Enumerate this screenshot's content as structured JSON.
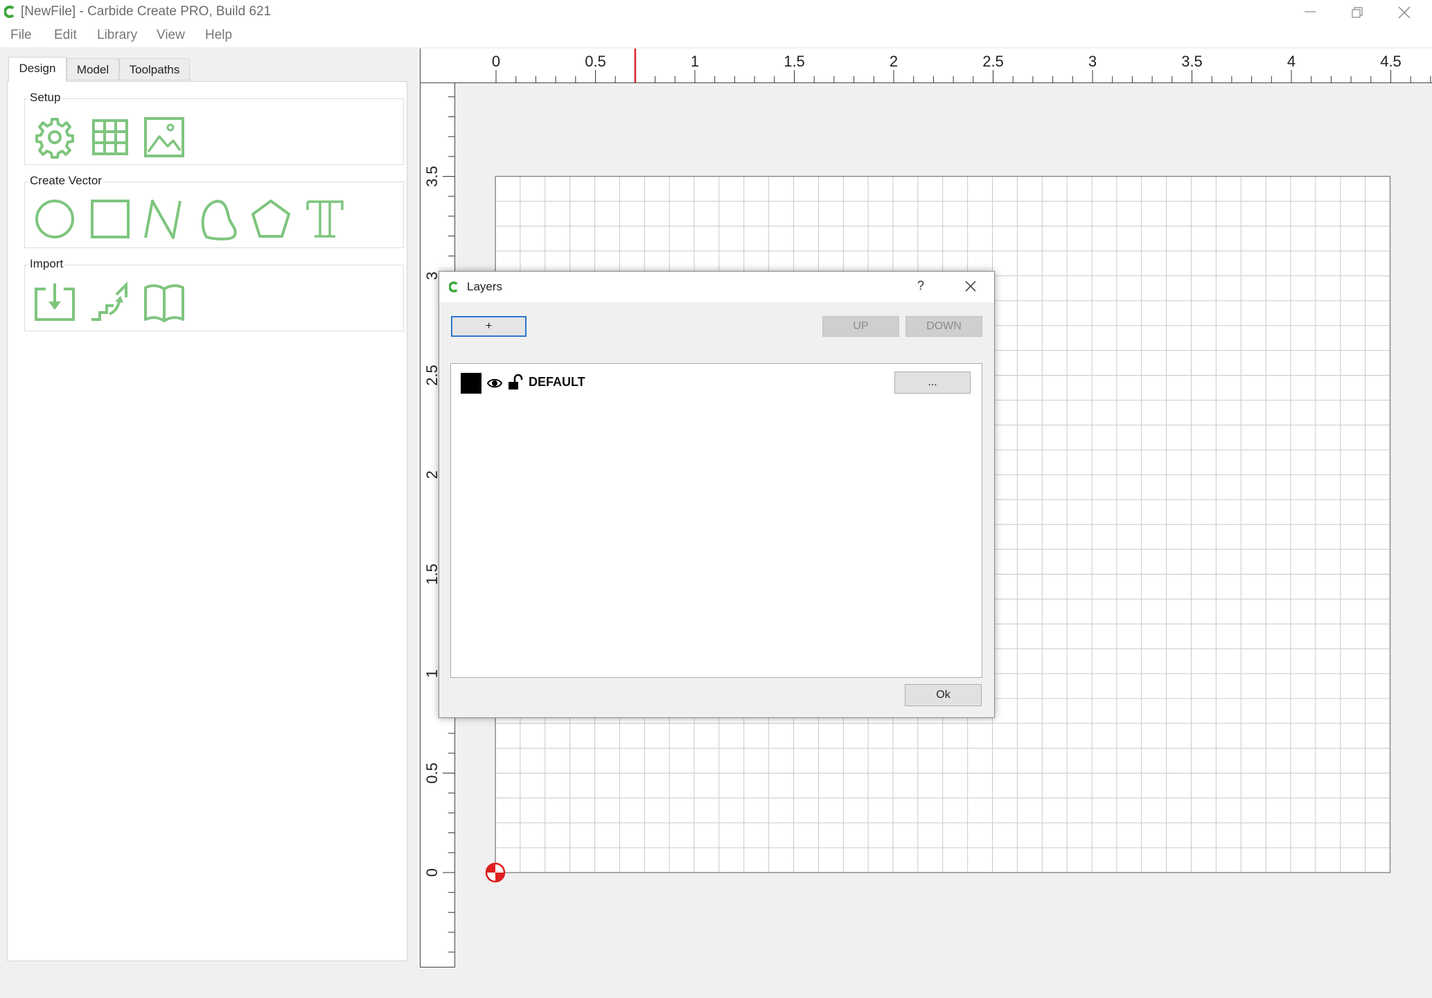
{
  "window": {
    "title": "[NewFile] - Carbide Create PRO, Build 621"
  },
  "menu": [
    "File",
    "Edit",
    "Library",
    "View",
    "Help"
  ],
  "tabs": [
    "Design",
    "Model",
    "Toolpaths"
  ],
  "groups": {
    "setup": {
      "label": "Setup",
      "tools": [
        "gear-icon",
        "grid-icon",
        "image-icon"
      ]
    },
    "create_vector": {
      "label": "Create Vector",
      "tools": [
        "circle-icon",
        "rectangle-icon",
        "polyline-icon",
        "curve-icon",
        "polygon-icon",
        "text-icon"
      ]
    },
    "import": {
      "label": "Import",
      "tools": [
        "import-icon",
        "tracing-icon",
        "library-icon"
      ]
    }
  },
  "ruler": {
    "top_labels": [
      "0",
      "0.5",
      "1",
      "1.5",
      "2",
      "2.5",
      "3",
      "3.5",
      "4",
      "4.5"
    ],
    "left_labels": [
      "3.5",
      "3",
      "2.5",
      "2",
      "1.5",
      "1",
      "0.5",
      "0"
    ],
    "cursor_x": 0.7
  },
  "grid": {
    "width_in": 4.5,
    "height_in": 3.5,
    "spacing_in": 0.125
  },
  "colors": {
    "accent_green": "#7ec57e",
    "cursor_red": "#e02020",
    "focus_blue": "#2b78d0"
  },
  "dialog": {
    "title": "Layers",
    "help": "?",
    "add_label": "+",
    "up_label": "UP",
    "down_label": "DOWN",
    "layers": [
      {
        "name": "DEFAULT",
        "color": "#000000",
        "visible": true,
        "locked": false,
        "menu_label": "..."
      }
    ],
    "ok_label": "Ok"
  }
}
